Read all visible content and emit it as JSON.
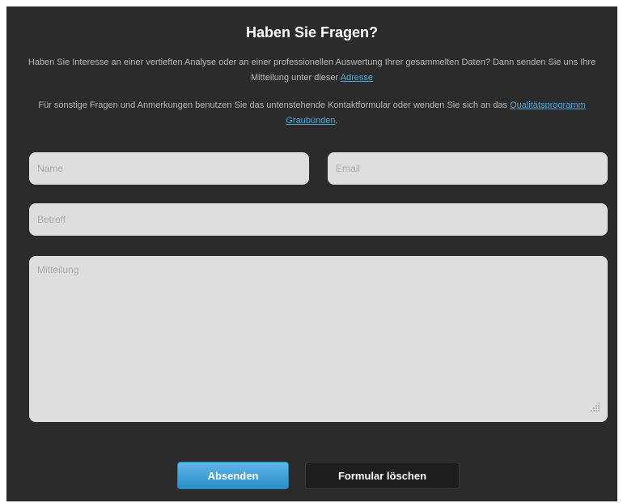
{
  "contact": {
    "title": "Haben Sie Fragen?",
    "intro": {
      "text": "Haben Sie Interesse an einer vertieften Analyse oder an einer professionellen Auswertung Ihrer gesammelten Daten? Dann senden Sie uns Ihre Mitteilung unter dieser ",
      "link": "Adresse"
    },
    "other": {
      "text": "Für sonstige Fragen und Anmerkungen benutzen Sie das untenstehende Kontaktformular oder wenden Sie sich an das ",
      "link": "Qualitätsprogramm Graubünden",
      "suffix": "."
    }
  },
  "form": {
    "name_placeholder": "Name",
    "email_placeholder": "Email",
    "subject_placeholder": "Betreff",
    "message_placeholder": "Mitteilung",
    "send_label": "Absenden",
    "reset_label": "Formular löschen"
  },
  "colors": {
    "background": "#2b2b2b",
    "field": "#dedede",
    "link": "#4fa8dc",
    "primary_button": "#3a9fd8",
    "secondary_button": "#1e1e1e"
  }
}
